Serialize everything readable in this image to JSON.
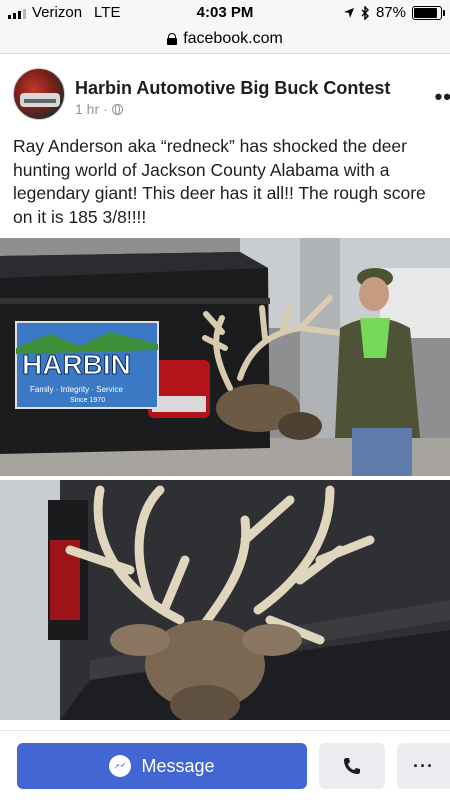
{
  "status_bar": {
    "carrier": "Verizon",
    "network": "LTE",
    "time": "4:03 PM",
    "battery": "87%",
    "battery_level": 0.87
  },
  "url_bar": {
    "domain": "facebook.com"
  },
  "post": {
    "page_name": "Harbin Automotive Big Buck Contest",
    "time_ago": "1 hr",
    "separator": "·",
    "text_lines": [
      "Ray Anderson aka “redneck” has shocked the deer",
      "hunting world of Jackson County Alabama with a",
      "legendary giant! This deer has it all!! The rough score",
      "on it is 185 3/8!!!!"
    ],
    "photo_1": {
      "sign_title": "HARBIN",
      "sign_line": "Family · Integrity · Service",
      "sign_since": "Since 1970"
    }
  },
  "actions": {
    "message_label": "Message",
    "more_label": "···"
  },
  "colors": {
    "accent": "#4267d2",
    "secondary_button": "#ebedf0",
    "meta_text": "#8d949e"
  },
  "icons": {
    "lock": "lock-icon",
    "globe": "globe-icon",
    "messenger": "messenger-icon",
    "phone": "phone-icon",
    "more": "more-icon"
  }
}
